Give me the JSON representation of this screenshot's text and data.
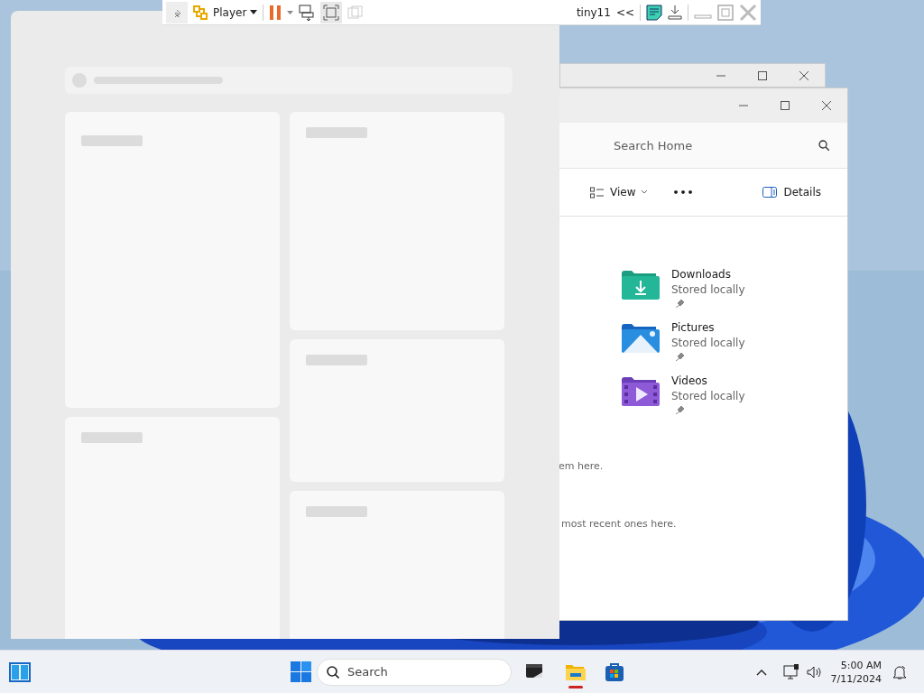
{
  "vm_toolbar": {
    "menu": "Player",
    "vm_name": "tiny11",
    "collapse": "<<"
  },
  "explorer_window": {
    "search": {
      "placeholder": "Search Home"
    },
    "toolbar": {
      "view": "View",
      "more": "•••",
      "details": "Details"
    },
    "quick_access": [
      {
        "name": "Downloads",
        "status": "Stored locally",
        "kind": "downloads",
        "pinned": true
      },
      {
        "name": "Pictures",
        "status": "Stored locally",
        "kind": "pictures",
        "pinned": true
      },
      {
        "name": "Videos",
        "status": "Stored locally",
        "kind": "videos",
        "pinned": true
      }
    ],
    "messages": [
      "em here.",
      "most recent ones here."
    ]
  },
  "taskbar": {
    "search": {
      "placeholder": "Search"
    },
    "apps": [
      {
        "kind": "terminal",
        "active": false
      },
      {
        "kind": "explorer",
        "active": true
      },
      {
        "kind": "store",
        "active": false
      }
    ],
    "time": "5:00 AM",
    "date": "7/11/2024"
  }
}
